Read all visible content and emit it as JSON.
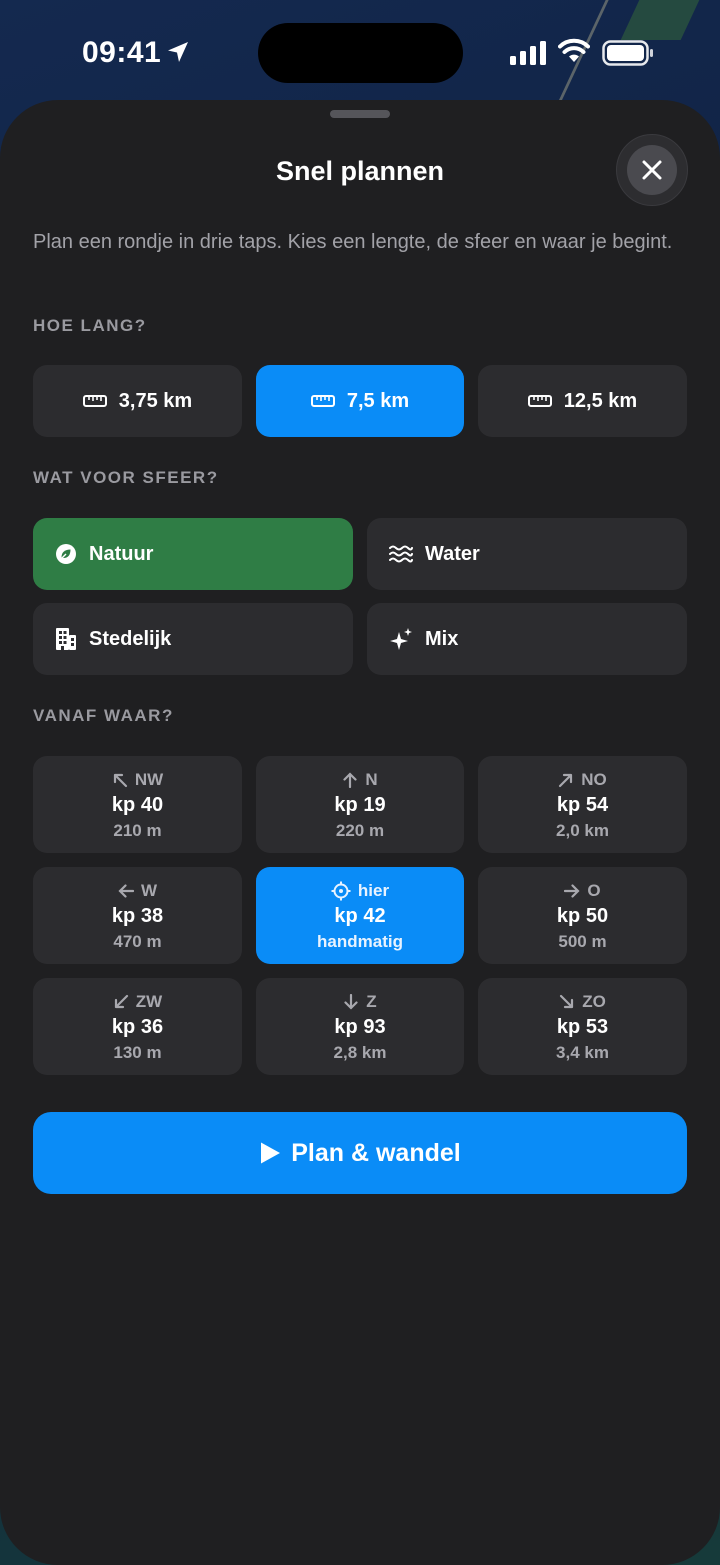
{
  "status_bar": {
    "time": "09:41"
  },
  "sheet": {
    "title": "Snel plannen",
    "subtitle": "Plan een rondje in drie taps. Kies een lengte, de sfeer en waar je begint."
  },
  "length_section": {
    "label": "HOE LANG?",
    "options": [
      {
        "label": "3,75 km",
        "icon": "ruler-icon",
        "selected": false
      },
      {
        "label": "7,5 km",
        "icon": "ruler-icon",
        "selected": true
      },
      {
        "label": "12,5 km",
        "icon": "ruler-icon",
        "selected": false
      }
    ]
  },
  "mood_section": {
    "label": "WAT VOOR SFEER?",
    "options": [
      {
        "label": "Natuur",
        "icon": "leaf-icon",
        "selected": true
      },
      {
        "label": "Water",
        "icon": "waves-icon",
        "selected": false
      },
      {
        "label": "Stedelijk",
        "icon": "building-icon",
        "selected": false
      },
      {
        "label": "Mix",
        "icon": "sparkles-icon",
        "selected": false
      }
    ]
  },
  "start_section": {
    "label": "VANAF WAAR?",
    "cards": [
      {
        "dir": "NW",
        "icon": "arrow-up-left-icon",
        "kp": "kp 40",
        "dist": "210 m",
        "selected": false
      },
      {
        "dir": "N",
        "icon": "arrow-up-icon",
        "kp": "kp 19",
        "dist": "220 m",
        "selected": false
      },
      {
        "dir": "NO",
        "icon": "arrow-up-right-icon",
        "kp": "kp 54",
        "dist": "2,0 km",
        "selected": false
      },
      {
        "dir": "W",
        "icon": "arrow-left-icon",
        "kp": "kp 38",
        "dist": "470 m",
        "selected": false
      },
      {
        "dir": "hier",
        "icon": "crosshair-icon",
        "kp": "kp 42",
        "dist": "handmatig",
        "selected": true
      },
      {
        "dir": "O",
        "icon": "arrow-right-icon",
        "kp": "kp 50",
        "dist": "500 m",
        "selected": false
      },
      {
        "dir": "ZW",
        "icon": "arrow-down-left-icon",
        "kp": "kp 36",
        "dist": "130 m",
        "selected": false
      },
      {
        "dir": "Z",
        "icon": "arrow-down-icon",
        "kp": "kp 93",
        "dist": "2,8 km",
        "selected": false
      },
      {
        "dir": "ZO",
        "icon": "arrow-down-right-icon",
        "kp": "kp 53",
        "dist": "3,4 km",
        "selected": false
      }
    ]
  },
  "cta": {
    "label": "Plan & wandel",
    "icon": "play-icon"
  },
  "colors": {
    "accent_blue": "#0a8cf7",
    "accent_green": "#2f7d45",
    "sheet_bg": "#1f1f21",
    "chip_bg": "#2c2c2f"
  }
}
